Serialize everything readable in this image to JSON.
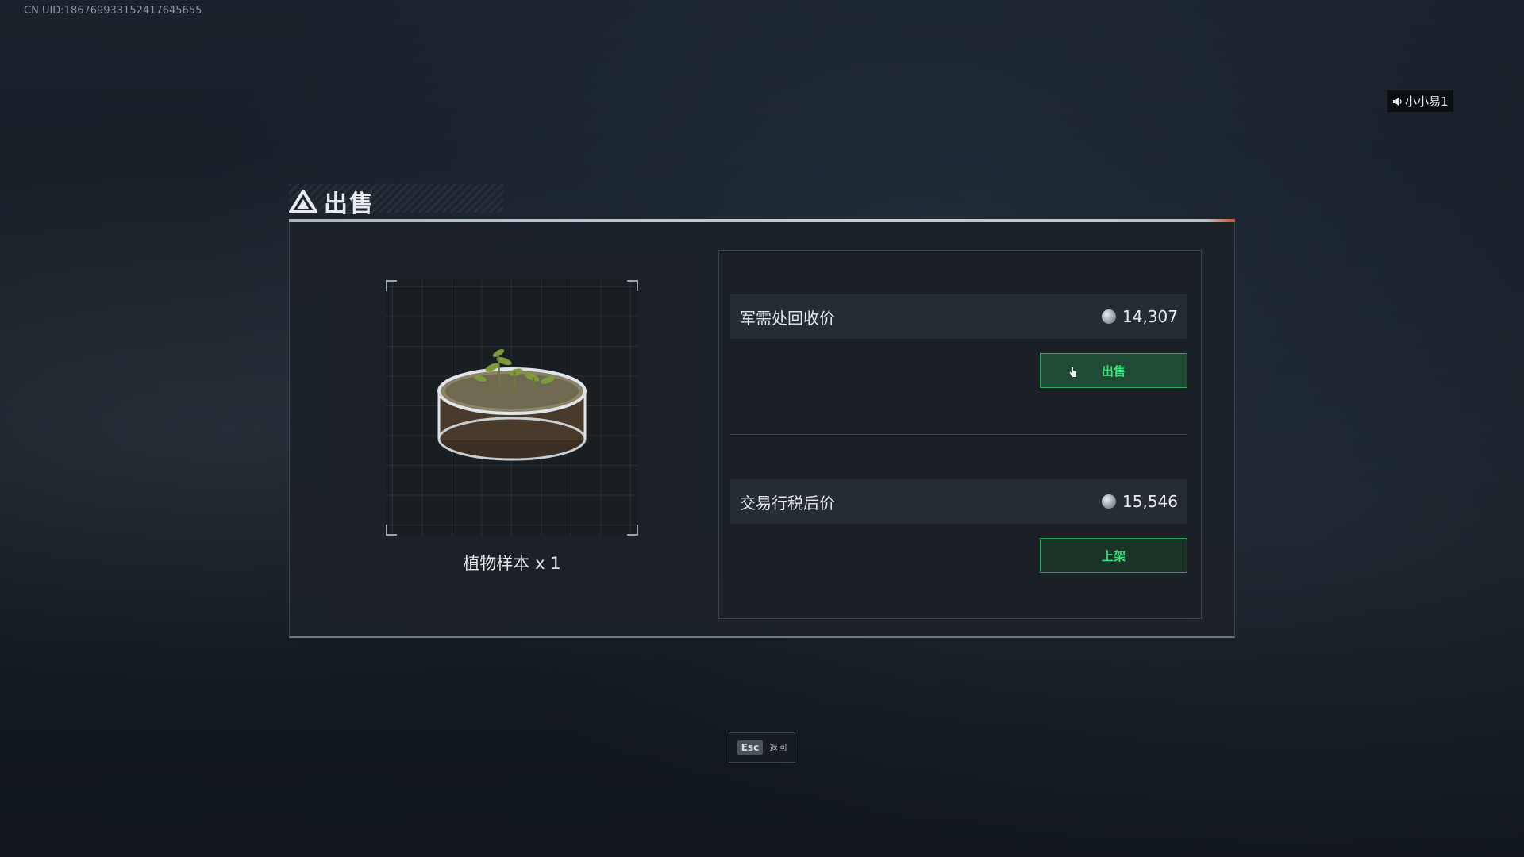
{
  "hud": {
    "uid": "CN UID:1867699331524176456​55",
    "voice_user": "小小易1"
  },
  "dialog": {
    "title": "出售",
    "item_name": "植物样本 x 1"
  },
  "prices": {
    "recycle_label": "军需处回收价",
    "recycle_value": "14,307",
    "sell_button": "出售",
    "trade_label": "交易行税后价",
    "trade_value": "15,546",
    "list_button": "上架"
  },
  "footer": {
    "esc_key": "Esc",
    "esc_label": "返回"
  },
  "colors": {
    "accent_green": "#3ddc7c",
    "button_bg": "#1f4a33",
    "header_accent": "#c2552e"
  },
  "icons": [
    "speaker-icon",
    "warning-triangle-icon",
    "coin-icon",
    "cursor-icon",
    "plant-sample-icon"
  ]
}
